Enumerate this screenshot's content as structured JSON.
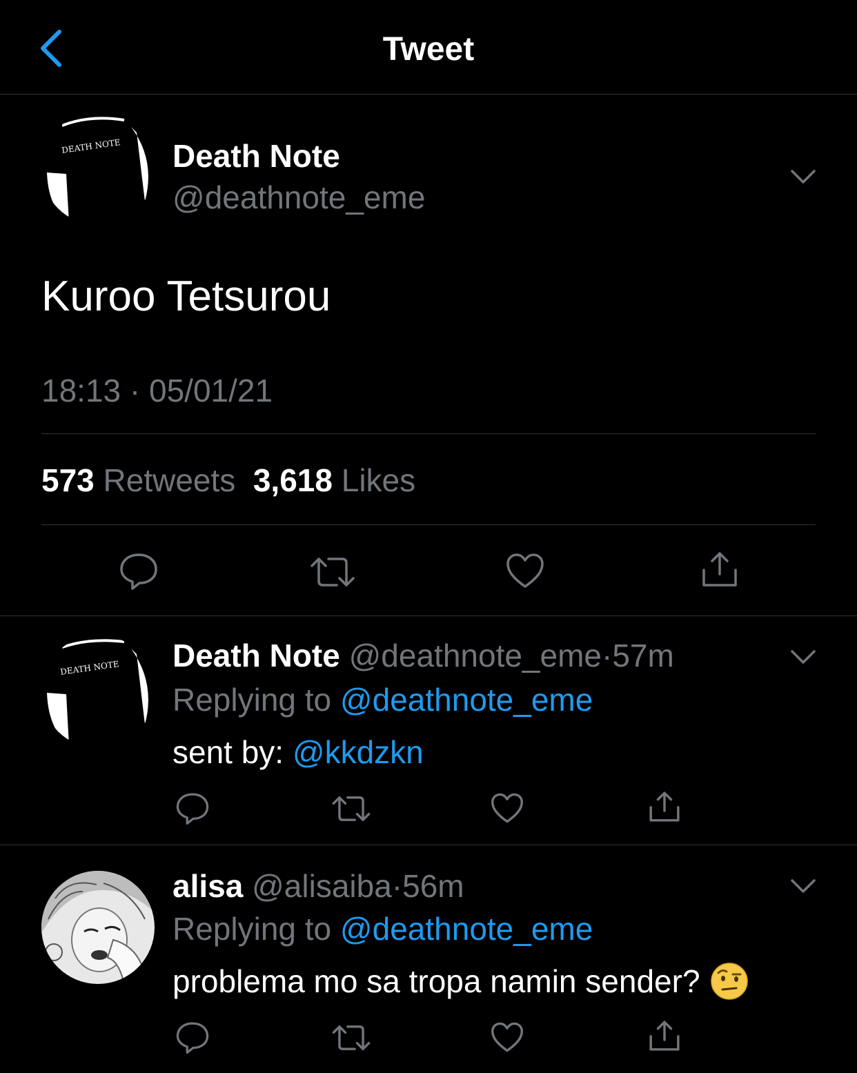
{
  "header": {
    "title": "Tweet"
  },
  "main_tweet": {
    "avatar_text": "DEATH NOTE",
    "name": "Death Note",
    "handle": "@deathnote_eme",
    "text": "Kuroo Tetsurou",
    "timestamp": "18:13 · 05/01/21",
    "retweets_count": "573",
    "retweets_label": "Retweets",
    "likes_count": "3,618",
    "likes_label": "Likes"
  },
  "replies": [
    {
      "avatar_text": "DEATH NOTE",
      "name": "Death Note",
      "handle": "@deathnote_eme",
      "dot": "·",
      "time": "57m",
      "replying_label": "Replying to",
      "replying_to": "@deathnote_eme",
      "text_prefix": "sent by:",
      "text_mention": "@kkdzkn"
    },
    {
      "name": "alisa",
      "handle": "@alisaiba",
      "dot": "·",
      "time": "56m",
      "replying_label": "Replying to",
      "replying_to": "@deathnote_eme",
      "text": "problema mo sa tropa namin sender?",
      "emoji": "face-with-raised-eyebrow"
    }
  ],
  "colors": {
    "background": "#000000",
    "text": "#ffffff",
    "muted": "#71767b",
    "link": "#1d9bf0",
    "divider": "#2f3336"
  },
  "icons": [
    "back-chevron-icon",
    "caret-down-icon",
    "reply-icon",
    "retweet-icon",
    "like-icon",
    "share-icon"
  ]
}
